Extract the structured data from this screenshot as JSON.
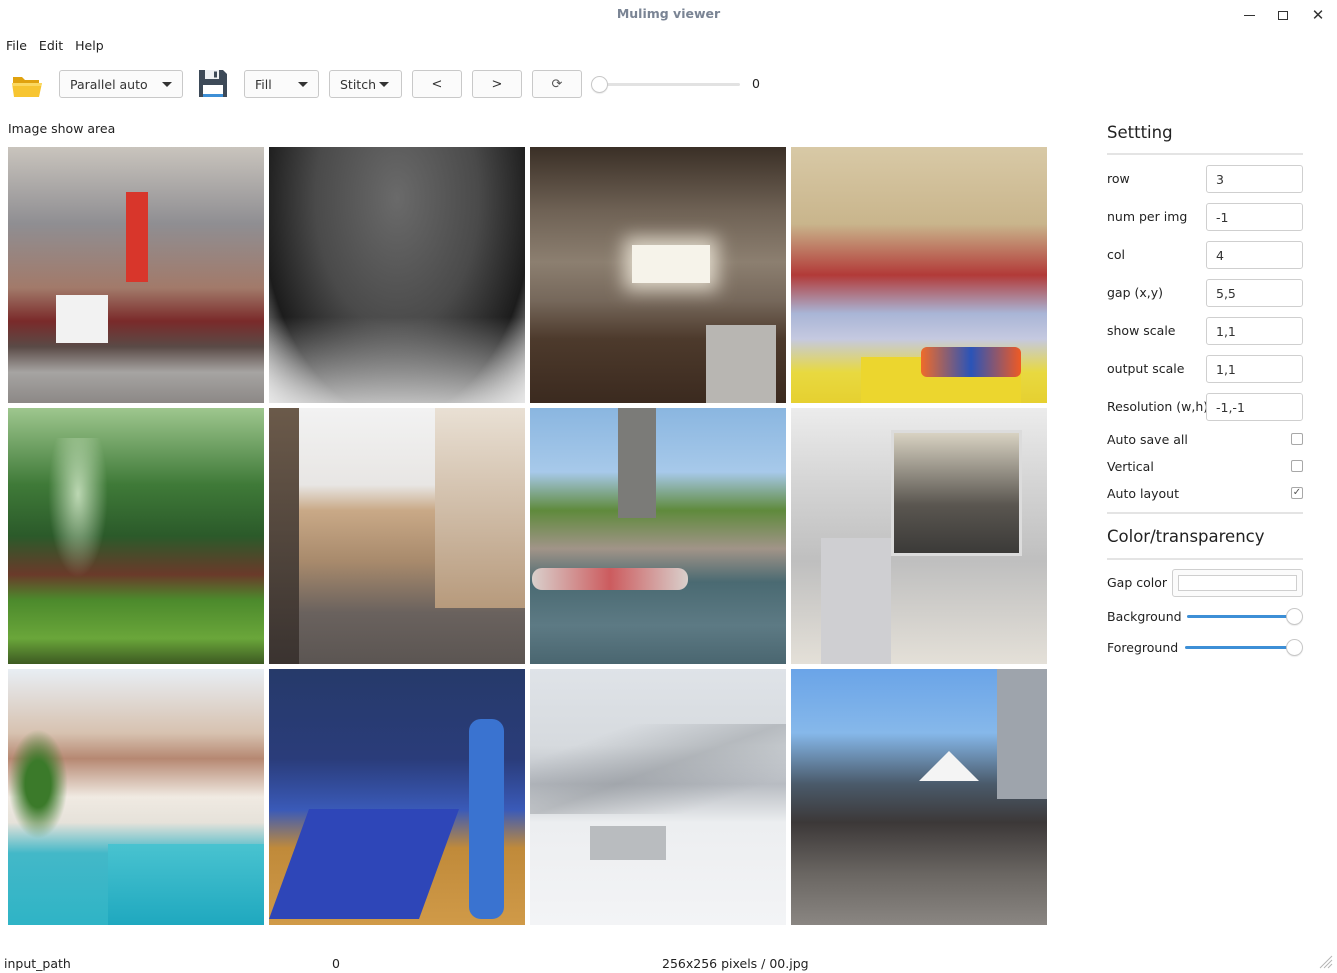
{
  "window": {
    "title": "Mulimg viewer",
    "controls": [
      "minimize",
      "maximize",
      "close"
    ],
    "close_glyph": "✕"
  },
  "menubar": {
    "items": [
      {
        "label": "File"
      },
      {
        "label": "Edit"
      },
      {
        "label": "Help"
      }
    ]
  },
  "toolbar": {
    "open_icon": "folder-open-icon",
    "parallel_mode": {
      "selected": "Parallel auto"
    },
    "save_icon": "floppy-save-icon",
    "fill_mode": {
      "selected": "Fill"
    },
    "stitch_mode": {
      "selected": "Stitch"
    },
    "prev_label": "<",
    "next_label": ">",
    "refresh_label": "⟳",
    "index_slider": {
      "value": 0,
      "value_label": "0"
    }
  },
  "image_area": {
    "label": "Image show area",
    "rows": 3,
    "cols": 4,
    "tiles": [
      {
        "description": "Street parade with red Canadian flag and FRY banner among high-rise buildings"
      },
      {
        "description": "Black-and-white view underneath a concrete bridge"
      },
      {
        "description": "Small kitchen with hanging pans, bright window, sink and washing machine"
      },
      {
        "description": "Young girl and caregiver playing with colorful toy blocks in a classroom"
      },
      {
        "description": "Misty green forest with moss-covered rocks"
      },
      {
        "description": "Old European street with arched arcade building and pedestrians"
      },
      {
        "description": "People rafting on a river beneath a concrete arch bridge"
      },
      {
        "description": "Laboratory glovebox apparatus with equipment"
      },
      {
        "description": "Tropical villa with tiled roof and turquoise swimming pool"
      },
      {
        "description": "Students in blue shirts standing on a gym basketball court"
      },
      {
        "description": "Snowy mountain slope with a billboard and skiers"
      },
      {
        "description": "Large crowd at an outdoor rally with Cuban flag and white tent"
      }
    ]
  },
  "settings": {
    "title": "Settting",
    "fields": [
      {
        "label": "row",
        "value": "3"
      },
      {
        "label": "num per img",
        "value": "-1"
      },
      {
        "label": "col",
        "value": "4"
      },
      {
        "label": "gap (x,y)",
        "value": "5,5"
      },
      {
        "label": "show scale",
        "value": "1,1"
      },
      {
        "label": "output scale",
        "value": "1,1"
      },
      {
        "label": "Resolution (w,h)",
        "value": "-1,-1"
      }
    ],
    "checkboxes": [
      {
        "label": "Auto save all",
        "checked": false,
        "glyph": ""
      },
      {
        "label": "Vertical",
        "checked": false,
        "glyph": ""
      },
      {
        "label": "Auto layout",
        "checked": true,
        "glyph": "✓"
      }
    ]
  },
  "color_transparency": {
    "title": "Color/transparency",
    "gap_color": {
      "label": "Gap color",
      "value": "#ffffff"
    },
    "background": {
      "label": "Background",
      "value_fraction": 1.0
    },
    "foreground": {
      "label": "Foreground",
      "value_fraction": 1.0
    },
    "slider_color": "#3d8fd6"
  },
  "statusbar": {
    "path_label": "input_path",
    "index": "0",
    "info": "256x256 pixels / 00.jpg"
  }
}
